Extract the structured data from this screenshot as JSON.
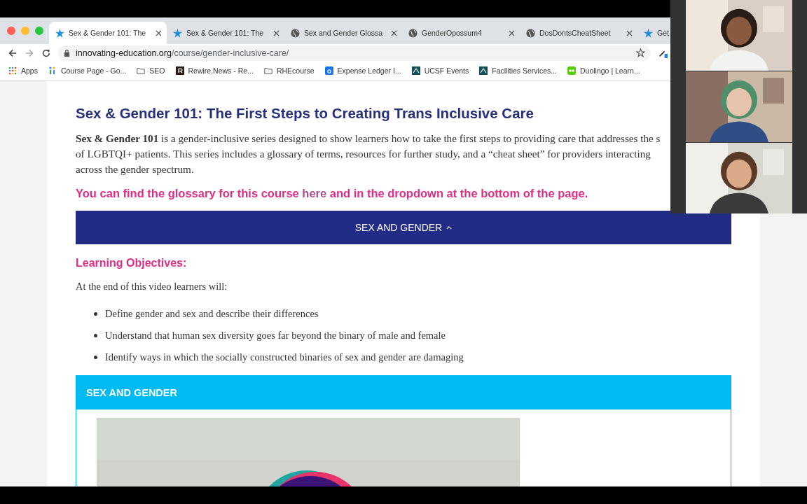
{
  "tabs": [
    {
      "title": "Sex & Gender 101: The",
      "kind": "star",
      "selected": true
    },
    {
      "title": "Sex & Gender 101: The",
      "kind": "star",
      "selected": false
    },
    {
      "title": "Sex and Gender Glossa",
      "kind": "globe",
      "selected": false
    },
    {
      "title": "GenderOpossum4",
      "kind": "globe",
      "selected": false
    },
    {
      "title": "DosDontsCheatSheet",
      "kind": "globe",
      "selected": false
    },
    {
      "title": "Get",
      "kind": "star",
      "selected": false
    }
  ],
  "address": {
    "host": "innovating-education.org",
    "path": "/course/gender-inclusive-care/"
  },
  "bookmarks": [
    {
      "label": "Apps",
      "kind": "apps"
    },
    {
      "label": "Course Page - Go...",
      "kind": "dots"
    },
    {
      "label": "SEO",
      "kind": "folder"
    },
    {
      "label": "Rewire.News - Re...",
      "kind": "r"
    },
    {
      "label": "RHEcourse",
      "kind": "folder"
    },
    {
      "label": "Expense Ledger I...",
      "kind": "box"
    },
    {
      "label": "UCSF Events",
      "kind": "square"
    },
    {
      "label": "Facilities Services...",
      "kind": "square"
    },
    {
      "label": "Duolingo | Learn...",
      "kind": "owl"
    }
  ],
  "page": {
    "heading": "Sex & Gender 101: The First Steps to Creating Trans Inclusive Care",
    "intro_lines": [
      "**Sex & Gender 101** is a gender-inclusive series designed to show learners how to take the first steps to providing care that addresses the s",
      "of LGBTQI+ patients. This series includes a glossary of terms, resources for further study, and a “cheat sheet” for providers interacting",
      "across the gender spectrum."
    ],
    "glossary_note": {
      "before": "You can find the glossary for this course",
      "link": "here",
      "after": "and in the dropdown at the bottom of the page."
    },
    "accordion": {
      "label": "SEX AND GENDER",
      "expanded": true
    },
    "objectives_title": "Learning Objectives:",
    "objectives_lead": "At the end of this video learners will:",
    "objectives": [
      "Define gender and sex and describe their differences",
      "Understand that human sex diversity goes far beyond the binary of male and female",
      "Identify ways in which the socially constructed binaries of sex and gender are damaging"
    ],
    "video_panel": {
      "title": "SEX AND GENDER"
    }
  }
}
